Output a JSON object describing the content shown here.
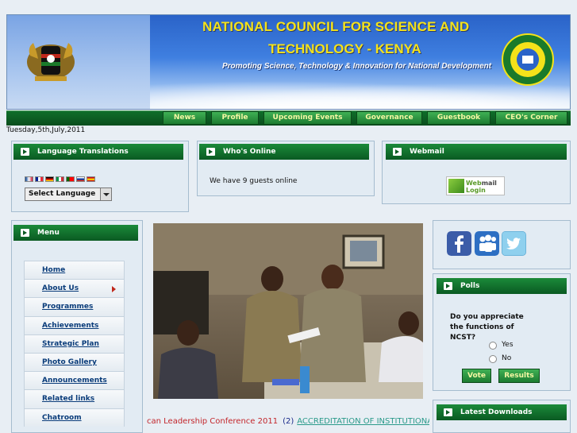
{
  "header": {
    "title_line1": "NATIONAL COUNCIL FOR SCIENCE AND",
    "title_line2": "TECHNOLOGY - KENYA",
    "tagline": "Promoting Science, Technology & Innovation for National Development"
  },
  "nav": {
    "items": [
      {
        "label": "News"
      },
      {
        "label": "Profile"
      },
      {
        "label": "Upcoming Events"
      },
      {
        "label": "Governance"
      },
      {
        "label": "Guestbook"
      },
      {
        "label": "CEO's Corner"
      }
    ]
  },
  "date": "Tuesday,5th,July,2011",
  "language": {
    "title": "Language Translations",
    "select_value": "Select Language"
  },
  "online": {
    "title": "Who's Online",
    "text": "We have 9 guests online"
  },
  "webmail": {
    "title": "Webmail",
    "logo_line1_a": "Web",
    "logo_line1_b": "mail",
    "logo_line2": "Login"
  },
  "menu": {
    "title": "Menu",
    "items": [
      {
        "label": "Home"
      },
      {
        "label": "About Us"
      },
      {
        "label": "Programmes"
      },
      {
        "label": "Achievements"
      },
      {
        "label": "Strategic Plan"
      },
      {
        "label": "Photo Gallery"
      },
      {
        "label": "Announcements"
      },
      {
        "label": "Related links"
      },
      {
        "label": "Chatroom"
      }
    ]
  },
  "ticker": {
    "text1": "can Leadership Conference 2011",
    "num": "(2)",
    "text2": "ACCREDITATION OF INSTITUTIONAL"
  },
  "polls": {
    "title": "Polls",
    "question": "Do you appreciate the functions of NCST?",
    "options": [
      "Yes",
      "No"
    ],
    "vote_label": "Vote",
    "results_label": "Results"
  },
  "downloads": {
    "title": "Latest Downloads"
  },
  "colors": {
    "panel_header": "#0a5a22",
    "title_yellow": "#f4e21a",
    "link_blue": "#0a3c7a"
  }
}
